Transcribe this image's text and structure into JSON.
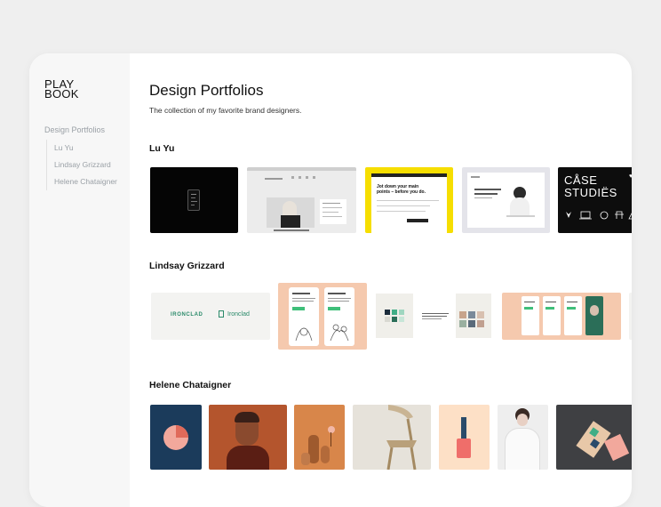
{
  "sidebar": {
    "logo_line1": "PLAY",
    "logo_line2": "BOOK",
    "nav_title": "Design Portfolios",
    "items": [
      {
        "label": "Lu Yu"
      },
      {
        "label": "Lindsay Grizzard"
      },
      {
        "label": "Helene Chataigner"
      }
    ]
  },
  "main": {
    "title": "Design Portfolios",
    "subtitle": "The collection of my favorite brand designers.",
    "sections": [
      {
        "title": "Lu Yu",
        "thumbs": {
          "yellow_heading": "Jot down your main points – before you do.",
          "case_studies_line1": "CÅSE",
          "case_studies_line2": "STUDIËS"
        }
      },
      {
        "title": "Lindsay Grizzard",
        "thumbs": {
          "ironclad_a": "IRONCLAD",
          "ironclad_b": "Ironclad"
        }
      },
      {
        "title": "Helene Chataigner"
      }
    ]
  },
  "colors": {
    "accent_yellow": "#f6de00",
    "peach": "#f5c9ae",
    "navy": "#1b3b5b",
    "rust": "#b4552d",
    "mint": "#3fbf7a",
    "dark": "#3f4043"
  }
}
